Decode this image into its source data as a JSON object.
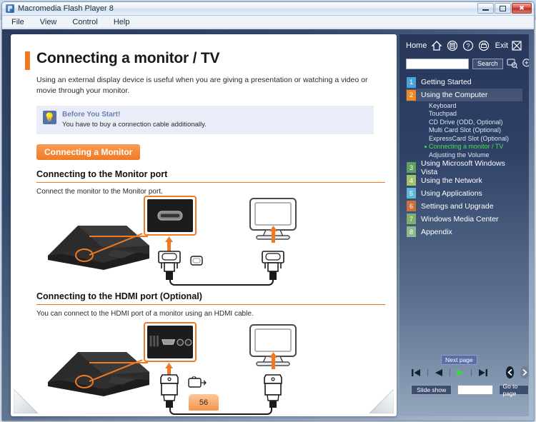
{
  "window": {
    "title": "Macromedia Flash Player 8",
    "app_icon": "flash-icon",
    "minimize_label": "Minimize",
    "maximize_label": "Maximize",
    "close_label": "Close"
  },
  "menubar": {
    "items": [
      {
        "label": "File"
      },
      {
        "label": "View"
      },
      {
        "label": "Control"
      },
      {
        "label": "Help"
      }
    ]
  },
  "document": {
    "title": "Connecting a monitor / TV",
    "intro": "Using an external display device is useful when you are giving a presentation or watching a video or movie through your monitor.",
    "tip": {
      "icon": "lightbulb-icon",
      "title": "Before You Start!",
      "text": "You have to buy a connection cable additionally."
    },
    "section_pill": "Connecting a Monitor",
    "sections": [
      {
        "heading": "Connecting to the Monitor port",
        "text": "Connect the monitor to the Monitor port."
      },
      {
        "heading": "Connecting to the HDMI port (Optional)",
        "text": "You can connect to the HDMI port of a monitor using an HDMI cable."
      }
    ],
    "page_number": "56"
  },
  "nav": {
    "home_label": "Home",
    "exit_label": "Exit",
    "icons": [
      {
        "name": "home-icon"
      },
      {
        "name": "bookmark-icon"
      },
      {
        "name": "help-icon"
      },
      {
        "name": "print-icon"
      }
    ],
    "exit_icon": "exit-icon",
    "search": {
      "value": "",
      "placeholder": "",
      "button_label": "Search"
    },
    "tool_icons": [
      {
        "name": "screen-search-icon"
      },
      {
        "name": "zoom-in-icon"
      }
    ],
    "toc": [
      {
        "number": "1",
        "label": "Getting Started",
        "color": "#4aa3d6",
        "active": false,
        "subitems": []
      },
      {
        "number": "2",
        "label": "Using the Computer",
        "color": "#ef8a20",
        "active": true,
        "subitems": [
          {
            "label": "Keyboard",
            "current": false
          },
          {
            "label": "Touchpad",
            "current": false
          },
          {
            "label": "CD Drive (ODD, Optional)",
            "current": false
          },
          {
            "label": "Multi Card Slot (Optional)",
            "current": false
          },
          {
            "label": "ExpressCard Slot (Optional)",
            "current": false
          },
          {
            "label": "Connecting a monitor / TV",
            "current": true
          },
          {
            "label": "Adjusting the Volume",
            "current": false
          }
        ]
      },
      {
        "number": "3",
        "label": "Using Microsoft Windows Vista",
        "color": "#5fa05a",
        "active": false,
        "subitems": []
      },
      {
        "number": "4",
        "label": "Using the Network",
        "color": "#9fc46a",
        "active": false,
        "subitems": []
      },
      {
        "number": "5",
        "label": "Using Applications",
        "color": "#63b8d8",
        "active": false,
        "subitems": []
      },
      {
        "number": "6",
        "label": "Settings and Upgrade",
        "color": "#c8713a",
        "active": false,
        "subitems": []
      },
      {
        "number": "7",
        "label": "Windows Media Center",
        "color": "#7fae6e",
        "active": false,
        "subitems": []
      },
      {
        "number": "8",
        "label": "Appendix",
        "color": "#8fb98a",
        "active": false,
        "subitems": []
      }
    ],
    "controls": {
      "tooltip": "Next page",
      "first_label": "First page",
      "prev_label": "Previous page",
      "play_label": "Next page",
      "last_label": "Last page",
      "back_label": "Back",
      "forward_label": "Forward",
      "slideshow_label": "Slide show",
      "goto_value": "",
      "goto_label": "Go to page"
    }
  },
  "colors": {
    "accent_orange": "#f07a24",
    "panel_dark": "#28375a",
    "highlight_green": "#46e24a",
    "title_blue": "#6b7fb5"
  }
}
